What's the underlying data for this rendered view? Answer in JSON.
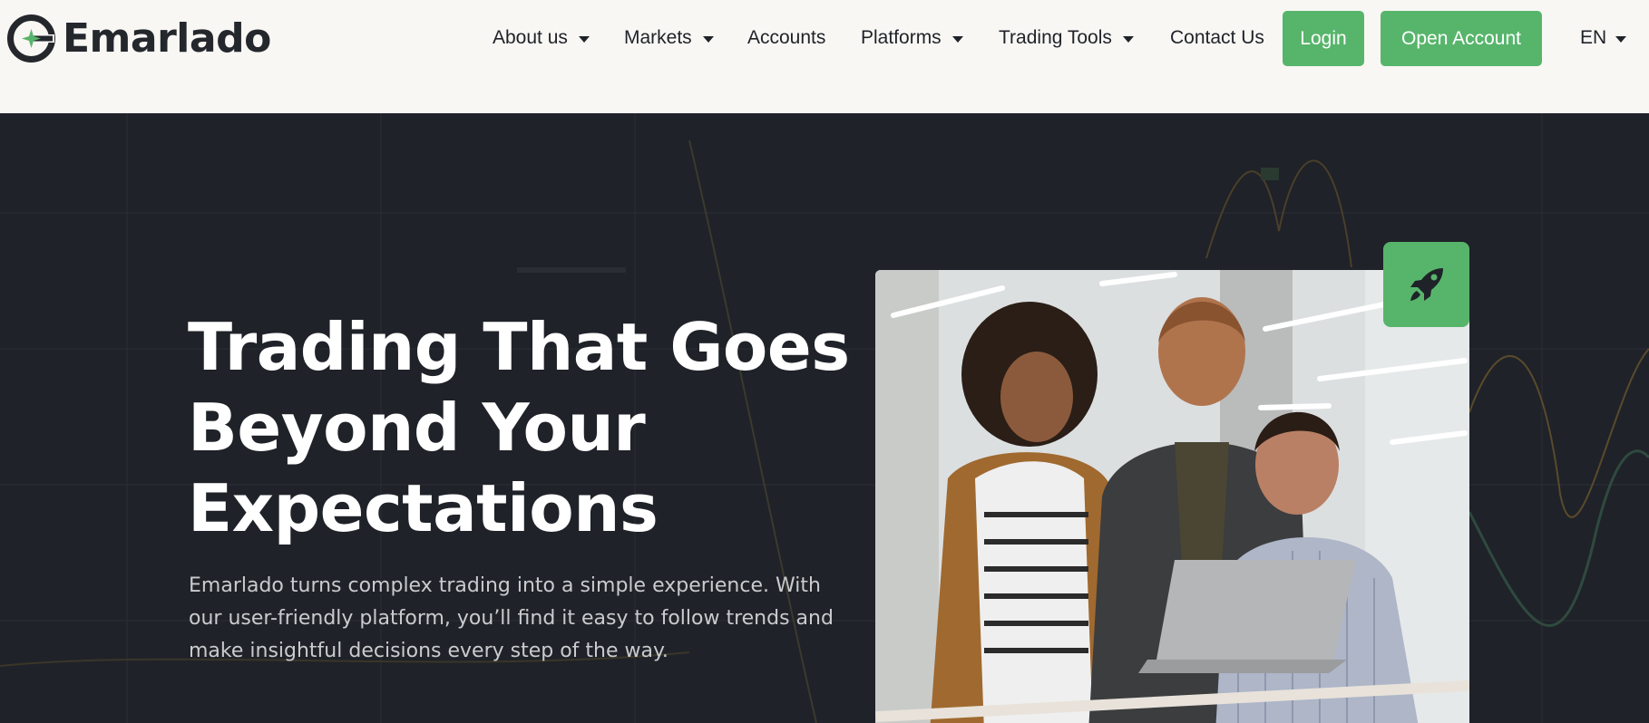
{
  "brand": {
    "name": "Emarlado",
    "logo_icon": "emarlado-logo-icon",
    "accent": "#57b56b"
  },
  "nav": {
    "items": [
      {
        "label": "About us",
        "dropdown": true
      },
      {
        "label": "Markets",
        "dropdown": true
      },
      {
        "label": "Accounts",
        "dropdown": false
      },
      {
        "label": "Platforms",
        "dropdown": true
      },
      {
        "label": "Trading Tools",
        "dropdown": true
      },
      {
        "label": "Contact Us",
        "dropdown": false
      }
    ],
    "login_label": "Login",
    "open_account_label": "Open Account",
    "language": "EN"
  },
  "hero": {
    "headline_lines": [
      "Trading That Goes",
      "Beyond Your",
      "Expectations"
    ],
    "description_lines": [
      "Emarlado turns complex trading into a simple experience. With",
      "our user-friendly platform, you’ll find it easy to follow trends and",
      "make insightful decisions every step of the way."
    ],
    "badge_icon": "rocket-icon",
    "image_subject": "three-colleagues-looking-at-laptop"
  },
  "colors": {
    "header_bg": "#f8f7f4",
    "hero_bg": "#1f2228",
    "text_dark": "#1f2228",
    "button": "#57b56b"
  }
}
